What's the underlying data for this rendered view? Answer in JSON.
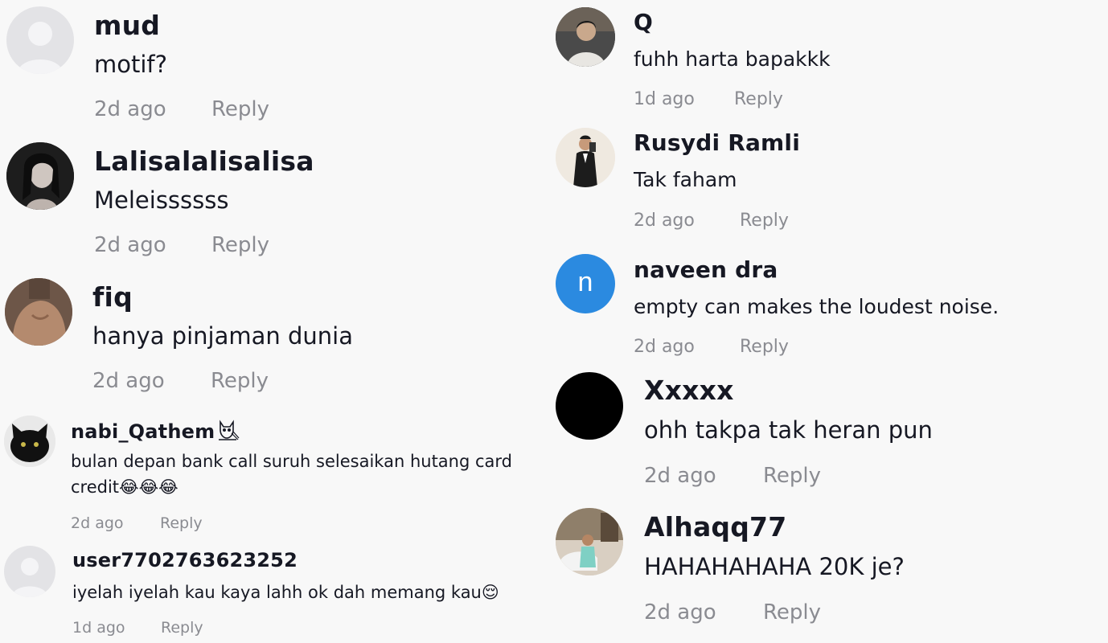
{
  "colors": {
    "background": "#f8f8f8",
    "username": "#161823",
    "text": "#161823",
    "meta": "#8a8b91",
    "avatar_default": "#e3e3e6",
    "avatar_n": "#2b8ae0"
  },
  "left_comments": [
    {
      "username": "mud",
      "text": "motif?",
      "time": "2d ago",
      "reply": "Reply",
      "avatar": "default-avatar-icon"
    },
    {
      "username": "Lalisalalisalisa",
      "text": "Meleissssss",
      "time": "2d ago",
      "reply": "Reply",
      "avatar": "user-photo-avatar"
    },
    {
      "username": "fiq",
      "text": "hanya pinjaman dunia",
      "time": "2d ago",
      "reply": "Reply",
      "avatar": "user-photo-avatar"
    },
    {
      "username": "nabi_Qathem",
      "username_icon": "owl-emoji",
      "text_line1": "bulan depan bank call suruh selesaikan hutang card",
      "text_line2": "credit😂😂😂",
      "time": "2d ago",
      "reply": "Reply",
      "avatar": "cat-photo-avatar"
    },
    {
      "username": "user7702763623252",
      "text": "iyelah iyelah kau kaya lahh ok dah memang kau😌",
      "time": "1d ago",
      "reply": "Reply",
      "avatar": "default-avatar-icon"
    }
  ],
  "right_comments": [
    {
      "username": "Q",
      "text": "fuhh harta bapakkk",
      "time": "1d ago",
      "reply": "Reply",
      "avatar": "user-photo-avatar"
    },
    {
      "username": "Rusydi Ramli",
      "text": "Tak faham",
      "time": "2d ago",
      "reply": "Reply",
      "avatar": "user-photo-avatar"
    },
    {
      "username": "naveen dra",
      "text": "empty can makes the loudest noise.",
      "time": "2d ago",
      "reply": "Reply",
      "avatar_letter": "n"
    },
    {
      "username": "Xxxxx",
      "text": "ohh takpa tak heran pun",
      "time": "2d ago",
      "reply": "Reply",
      "avatar": "black-avatar"
    },
    {
      "username": "Alhaqq77",
      "text": "HAHAHAHAHA 20K je?",
      "time": "2d ago",
      "reply": "Reply",
      "avatar": "user-photo-avatar"
    }
  ]
}
